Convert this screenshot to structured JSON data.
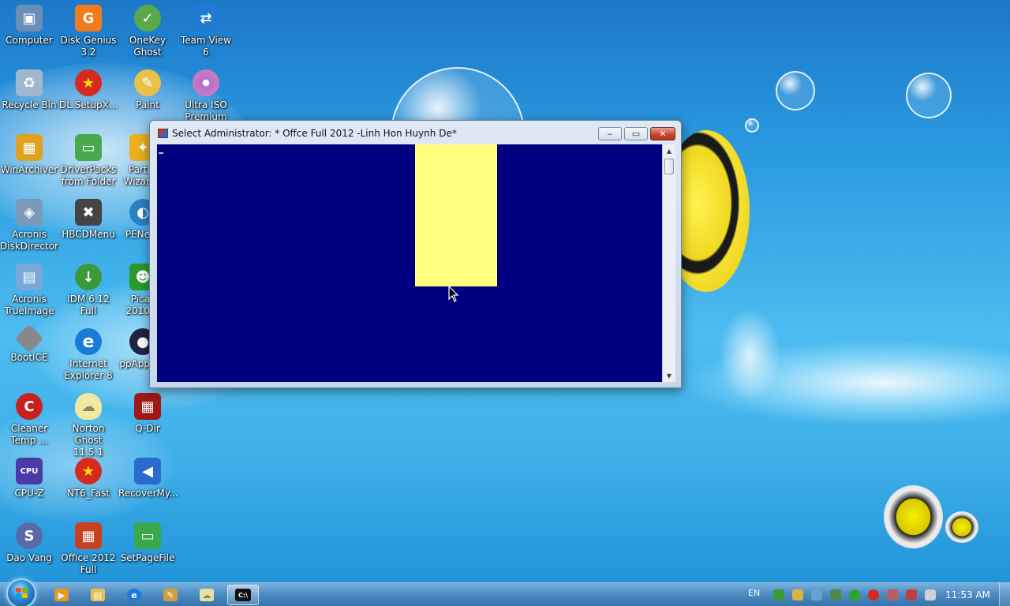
{
  "desktop": {
    "icons": [
      {
        "label": "Computer",
        "icon": "computer-icon",
        "color": "#6a8fb8"
      },
      {
        "label": "Disk Genius\n3.2",
        "icon": "disk-genius-icon",
        "color": "#f07c1c"
      },
      {
        "label": "OneKey\nGhost",
        "icon": "onekey-ghost-icon",
        "color": "#5aa84a"
      },
      {
        "label": "Team View 6",
        "icon": "teamviewer-icon",
        "color": "#1f7ad1"
      },
      {
        "label": "Recycle Bin",
        "icon": "recycle-bin-icon",
        "color": "#9fb8cf"
      },
      {
        "label": "DL.SetupX...",
        "icon": "star-icon",
        "color": "#d42a20"
      },
      {
        "label": "Paint",
        "icon": "paint-icon",
        "color": "#e8c04a"
      },
      {
        "label": "Ultra ISO\nPremium 9.5",
        "icon": "disc-icon",
        "color": "#b070c8"
      },
      {
        "label": "WinArchiver",
        "icon": "archive-icon",
        "color": "#e0a020"
      },
      {
        "label": "DriverPacks\nfrom Folder",
        "icon": "driverpacks-icon",
        "color": "#4aa850"
      },
      {
        "label": "Parti\nWizar",
        "icon": "partition-wizard-icon",
        "color": "#e8b020"
      },
      {
        "label": "Acronis\nDiskDirector",
        "icon": "acronis-dd-icon",
        "color": "#7a9ab8"
      },
      {
        "label": "HBCDMenu",
        "icon": "tools-icon",
        "color": "#444444"
      },
      {
        "label": "PENe",
        "icon": "penet-icon",
        "color": "#2a80c0"
      },
      {
        "label": "Acronis\nTrueImage",
        "icon": "acronis-ti-icon",
        "color": "#7aa8d8"
      },
      {
        "label": "IDM 6.12 Full",
        "icon": "idm-icon",
        "color": "#3a9a3a"
      },
      {
        "label": "Pica\n2010",
        "icon": "picasa-icon",
        "color": "#2a9a2a"
      },
      {
        "label": "BootICE",
        "icon": "bootice-icon",
        "color": "#888888"
      },
      {
        "label": "Internet\nExplorer 8",
        "icon": "ie-icon",
        "color": "#1a7ad8"
      },
      {
        "label": "ppApp",
        "icon": "app-icon",
        "color": "#222244"
      },
      {
        "label": "Cleaner\nTemp ...",
        "icon": "ccleaner-icon",
        "color": "#c82020"
      },
      {
        "label": "Norton\nGhost 11.5.1",
        "icon": "norton-ghost-icon",
        "color": "#f0e8a0"
      },
      {
        "label": "Q-Dir",
        "icon": "qdir-icon",
        "color": "#a01818"
      },
      {
        "label": "CPU-Z",
        "icon": "cpuz-icon",
        "color": "#4a3aa8"
      },
      {
        "label": "NT6_Fast",
        "icon": "star-icon",
        "color": "#d42a20"
      },
      {
        "label": "RecoverMy...",
        "icon": "recover-icon",
        "color": "#2a6ad0"
      },
      {
        "label": "Dao Vang",
        "icon": "dao-vang-icon",
        "color": "#5a6aa8"
      },
      {
        "label": "Office 2012\nFull",
        "icon": "office-icon",
        "color": "#c84020"
      },
      {
        "label": "SetPageFile",
        "icon": "setpagefile-icon",
        "color": "#3aa84a"
      }
    ]
  },
  "window": {
    "title": "Select Administrator:  * Offce Full 2012 -Linh Hon Huynh De*",
    "minimize_label": "‒",
    "maximize_label": "▭",
    "close_label": "✕",
    "console_bg": "#000080",
    "selection_color": "#ffff80"
  },
  "taskbar": {
    "lang": "EN",
    "clock": "11:53 AM",
    "apps": [
      {
        "name": "media-player",
        "glyph": "▶",
        "color": "#e89820"
      },
      {
        "name": "explorer",
        "glyph": "▤",
        "color": "#e8c050"
      },
      {
        "name": "internet-explorer",
        "glyph": "e",
        "color": "#1a7ad8"
      },
      {
        "name": "paint",
        "glyph": "✎",
        "color": "#d0a040"
      },
      {
        "name": "norton-ghost",
        "glyph": "☁",
        "color": "#e8e0a0"
      },
      {
        "name": "command-prompt",
        "glyph": "C:\\",
        "color": "#111111"
      }
    ]
  }
}
